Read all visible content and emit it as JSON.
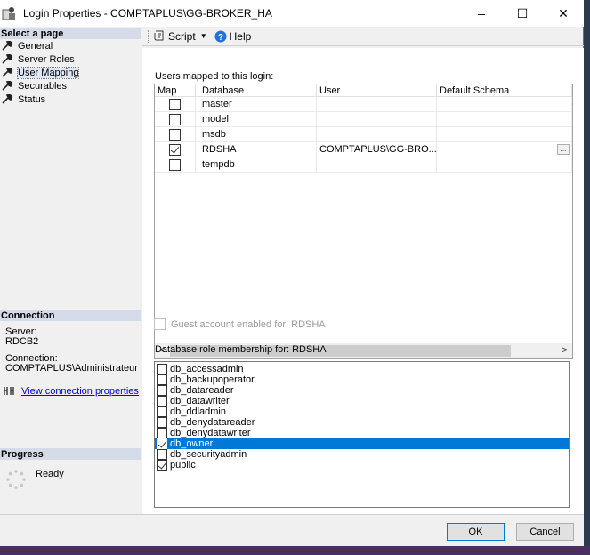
{
  "window": {
    "title": "Login Properties - COMPTAPLUS\\GG-BROKER_HA",
    "controls": {
      "minimize": "–",
      "maximize": "☐",
      "close": "✕"
    }
  },
  "left": {
    "select_page_header": "Select a page",
    "pages": [
      {
        "label": "General",
        "icon": "wrench-icon"
      },
      {
        "label": "Server Roles",
        "icon": "wrench-icon"
      },
      {
        "label": "User Mapping",
        "icon": "wrench-icon"
      },
      {
        "label": "Securables",
        "icon": "wrench-icon"
      },
      {
        "label": "Status",
        "icon": "wrench-icon"
      }
    ],
    "selected_page": "User Mapping",
    "connection": {
      "header": "Connection",
      "server_label": "Server:",
      "server_value": "RDCB2",
      "connection_label": "Connection:",
      "connection_value": "COMPTAPLUS\\Administrateur",
      "view_link": "View connection properties"
    },
    "progress": {
      "header": "Progress",
      "status": "Ready"
    }
  },
  "toolbar": {
    "script_label": "Script",
    "help_label": "Help"
  },
  "mapping": {
    "label": "Users mapped to this login:",
    "columns": [
      "Map",
      "Database",
      "User",
      "Default Schema"
    ],
    "rows": [
      {
        "map": false,
        "database": "master",
        "user": "",
        "schema": ""
      },
      {
        "map": false,
        "database": "model",
        "user": "",
        "schema": ""
      },
      {
        "map": false,
        "database": "msdb",
        "user": "",
        "schema": ""
      },
      {
        "map": true,
        "database": "RDSHA",
        "user": "COMPTAPLUS\\GG-BRO...",
        "schema": "",
        "ellipsis": "..."
      },
      {
        "map": false,
        "database": "tempdb",
        "user": "",
        "schema": ""
      }
    ],
    "scroll_left": "<",
    "scroll_right": ">"
  },
  "guest": {
    "label": "Guest account enabled for: RDSHA",
    "checked": false,
    "enabled": false
  },
  "roles": {
    "label": "Database role membership for: RDSHA",
    "items": [
      {
        "name": "db_accessadmin",
        "checked": false
      },
      {
        "name": "db_backupoperator",
        "checked": false
      },
      {
        "name": "db_datareader",
        "checked": false
      },
      {
        "name": "db_datawriter",
        "checked": false
      },
      {
        "name": "db_ddladmin",
        "checked": false
      },
      {
        "name": "db_denydatareader",
        "checked": false
      },
      {
        "name": "db_denydatawriter",
        "checked": false
      },
      {
        "name": "db_owner",
        "checked": true
      },
      {
        "name": "db_securityadmin",
        "checked": false
      },
      {
        "name": "public",
        "checked": true
      }
    ],
    "selected": "db_owner"
  },
  "buttons": {
    "ok": "OK",
    "cancel": "Cancel"
  }
}
